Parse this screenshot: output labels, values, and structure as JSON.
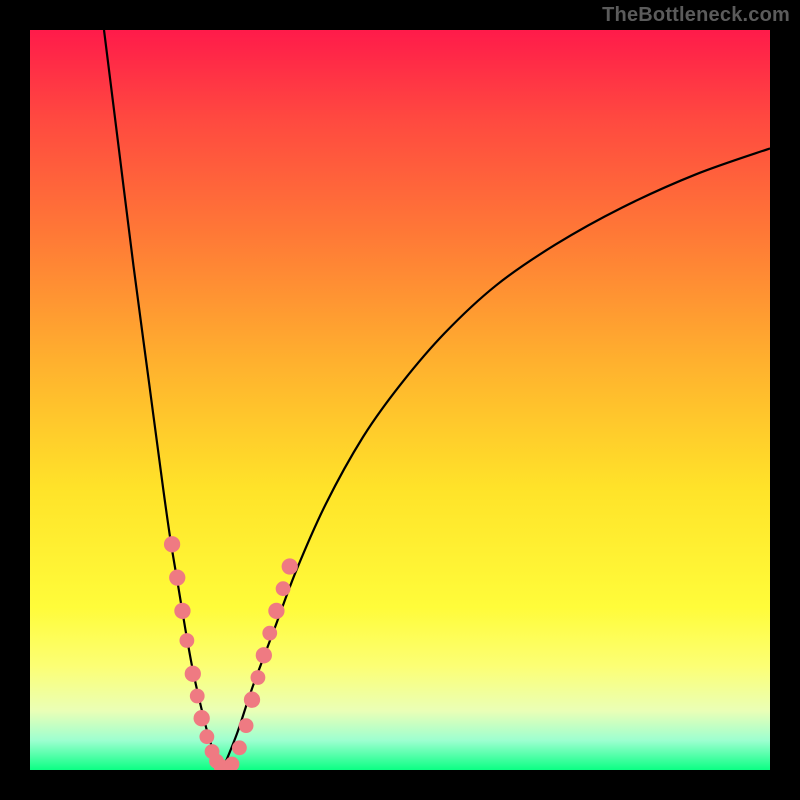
{
  "watermark": "TheBottleneck.com",
  "chart_data": {
    "type": "line",
    "title": "",
    "xlabel": "",
    "ylabel": "",
    "xlim": [
      0,
      100
    ],
    "ylim": [
      0,
      100
    ],
    "curve_left": {
      "name": "left-branch",
      "x": [
        10,
        12,
        14,
        16,
        18,
        19,
        20,
        21,
        22,
        23,
        24,
        25,
        26
      ],
      "y": [
        100,
        84,
        68,
        53,
        38,
        31,
        25,
        19,
        13.5,
        9,
        5,
        2,
        0
      ]
    },
    "curve_right": {
      "name": "right-branch",
      "x": [
        26,
        28,
        30,
        33,
        36,
        40,
        45,
        50,
        56,
        63,
        71,
        80,
        90,
        100
      ],
      "y": [
        0,
        5,
        11,
        19,
        27,
        36,
        45,
        52,
        59,
        65.5,
        71,
        76,
        80.5,
        84
      ]
    },
    "markers_left": {
      "name": "left-markers",
      "color": "#ef7a82",
      "points": [
        {
          "x": 19.2,
          "y": 30.5,
          "r": 1.1
        },
        {
          "x": 19.9,
          "y": 26.0,
          "r": 1.1
        },
        {
          "x": 20.6,
          "y": 21.5,
          "r": 1.1
        },
        {
          "x": 21.2,
          "y": 17.5,
          "r": 1.0
        },
        {
          "x": 22.0,
          "y": 13.0,
          "r": 1.1
        },
        {
          "x": 22.6,
          "y": 10.0,
          "r": 1.0
        },
        {
          "x": 23.2,
          "y": 7.0,
          "r": 1.1
        },
        {
          "x": 23.9,
          "y": 4.5,
          "r": 1.0
        },
        {
          "x": 24.6,
          "y": 2.5,
          "r": 1.0
        },
        {
          "x": 25.2,
          "y": 1.2,
          "r": 1.0
        },
        {
          "x": 25.8,
          "y": 0.5,
          "r": 1.0
        },
        {
          "x": 26.5,
          "y": 0.3,
          "r": 1.0
        },
        {
          "x": 27.3,
          "y": 0.8,
          "r": 1.0
        }
      ]
    },
    "markers_right": {
      "name": "right-markers",
      "color": "#ef7a82",
      "points": [
        {
          "x": 28.3,
          "y": 3.0,
          "r": 1.0
        },
        {
          "x": 29.2,
          "y": 6.0,
          "r": 1.0
        },
        {
          "x": 30.0,
          "y": 9.5,
          "r": 1.1
        },
        {
          "x": 30.8,
          "y": 12.5,
          "r": 1.0
        },
        {
          "x": 31.6,
          "y": 15.5,
          "r": 1.1
        },
        {
          "x": 32.4,
          "y": 18.5,
          "r": 1.0
        },
        {
          "x": 33.3,
          "y": 21.5,
          "r": 1.1
        },
        {
          "x": 34.2,
          "y": 24.5,
          "r": 1.0
        },
        {
          "x": 35.1,
          "y": 27.5,
          "r": 1.1
        }
      ]
    }
  }
}
